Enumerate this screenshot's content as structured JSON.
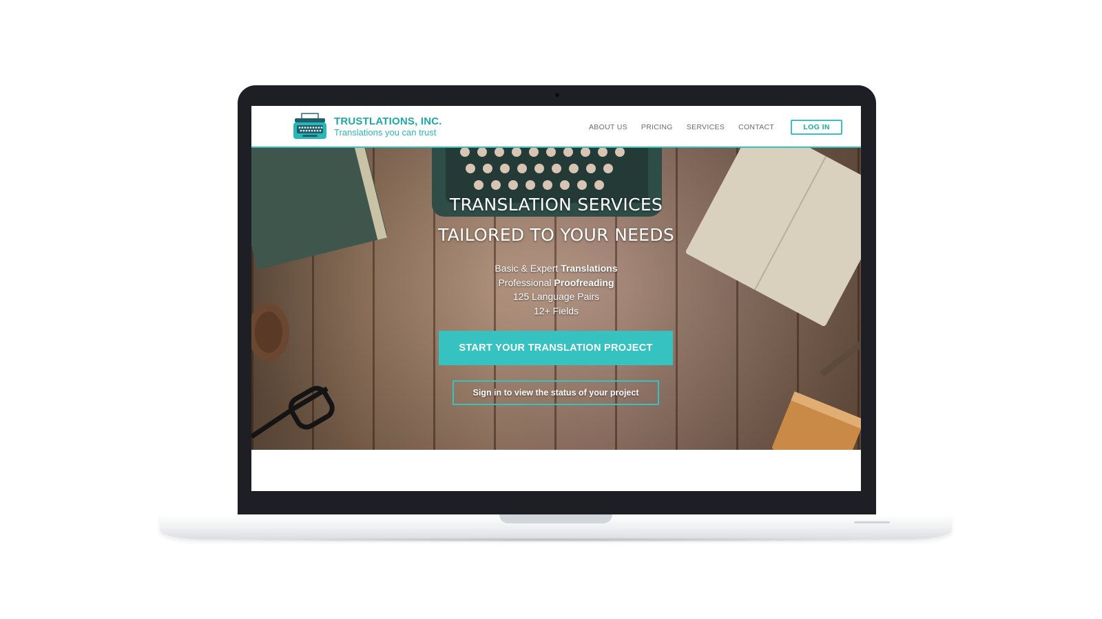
{
  "colors": {
    "accent": "#35c2c0",
    "accent_dark": "#1ba8a8",
    "nav_text": "#666a70",
    "laptop_frame": "#1e1f24"
  },
  "header": {
    "brand_name": "TRUSTLATIONS, INC.",
    "brand_tagline": "Translations you can trust",
    "logo_icon": "typewriter-icon",
    "nav": [
      "ABOUT US",
      "PRICING",
      "SERVICES",
      "CONTACT"
    ],
    "login_label": "LOG IN"
  },
  "hero": {
    "title_line1": "TRANSLATION SERVICES",
    "title_line2": "TAILORED TO YOUR NEEDS",
    "features": [
      {
        "plain": "Basic & Expert ",
        "bold": "Translations"
      },
      {
        "plain": "Professional ",
        "bold": "Proofreading"
      },
      {
        "plain": "125 Language Pairs",
        "bold": ""
      },
      {
        "plain": "12+ Fields",
        "bold": ""
      }
    ],
    "cta_primary": "START YOUR TRANSLATION PROJECT",
    "cta_secondary": "Sign in to view the status of your project"
  }
}
